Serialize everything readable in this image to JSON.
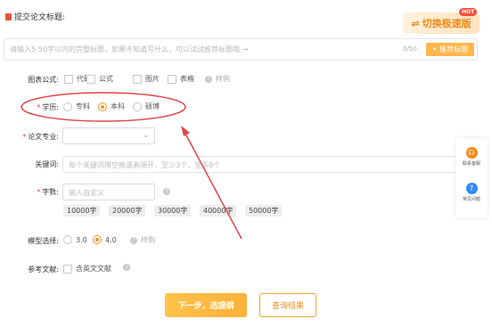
{
  "header": {
    "title": "提交论文标题:",
    "switch_label": "切换极速版",
    "switch_icon": "⇌",
    "hot_badge": "HOT"
  },
  "topic": {
    "placeholder": "请输入5-50字以内的完整标题，如果不知道写什么，可以试试推荐标题哦 →",
    "counter": "0/50",
    "recommend_label": "推荐标题",
    "recommend_icon": "✦"
  },
  "chart_types": {
    "label": "图表公式:",
    "options": [
      "代码",
      "公式",
      "图片",
      "表格"
    ],
    "sample": "样例"
  },
  "degree": {
    "label": "学历:",
    "options": [
      "专科",
      "本科",
      "硕博"
    ],
    "selected": "本科"
  },
  "major": {
    "label": "论文专业:",
    "value": ""
  },
  "keywords": {
    "label": "关键词:",
    "placeholder": "每个关键词用空格或者隔开，至少3个，至多8个"
  },
  "word_count": {
    "label": "字数:",
    "placeholder": "输入自定义",
    "presets": [
      "10000字",
      "20000字",
      "30000字",
      "40000字",
      "50000字"
    ]
  },
  "model": {
    "label": "模型选择:",
    "options": [
      "3.0",
      "4.0"
    ],
    "selected": "4.0",
    "sample": "样例"
  },
  "reference": {
    "label": "参考文献:",
    "option": "含英文文献"
  },
  "actions": {
    "next_label": "下一步，选提纲",
    "query_label": "查询结果"
  },
  "side_panel": {
    "contact_label": "联系客服",
    "faq_label": "常见问题"
  },
  "colors": {
    "accent": "#f0932b",
    "required": "#e64a3b",
    "annotation": "#e0454a"
  }
}
